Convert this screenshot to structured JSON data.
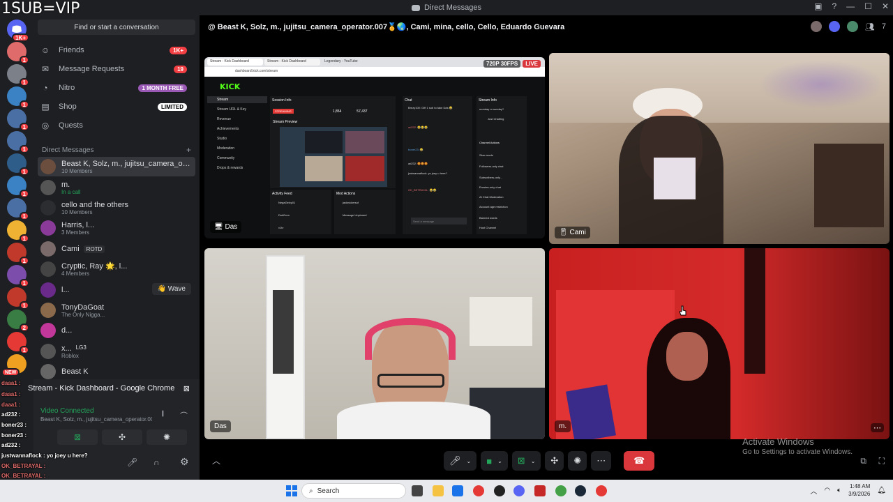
{
  "overlay_text": "1SUB=VIP",
  "window": {
    "title": "Direct Messages"
  },
  "sidebar": {
    "search_placeholder": "Find or start a conversation",
    "nav": [
      {
        "label": "Friends",
        "badge": "1K+"
      },
      {
        "label": "Message Requests",
        "badge": "19"
      },
      {
        "label": "Nitro",
        "badge": "1 MONTH FREE"
      },
      {
        "label": "Shop",
        "badge": "LIMITED"
      },
      {
        "label": "Quests",
        "badge": ""
      }
    ],
    "dm_header": "Direct Messages",
    "dms": [
      {
        "name": "Beast K, Solz, m., jujitsu_camera_opera...",
        "sub": "10 Members"
      },
      {
        "name": "m.",
        "sub": "In a call"
      },
      {
        "name": "cello and the others",
        "sub": "10 Members"
      },
      {
        "name": "Harris, l...",
        "sub": "3 Members"
      },
      {
        "name": "Cami",
        "sub": "",
        "tag": "ROTD"
      },
      {
        "name": "Cryptic, Ray 🌟, l...",
        "sub": "4 Members"
      },
      {
        "name": "l...",
        "sub": "",
        "action": "👋 Wave"
      },
      {
        "name": "TonyDaGoat",
        "sub": "The Only Nigga..."
      },
      {
        "name": "d...",
        "sub": ""
      },
      {
        "name": "x...",
        "sub": "Roblox",
        "tag": "LG3"
      },
      {
        "name": "Beast K",
        "sub": ""
      }
    ]
  },
  "rail": {
    "home_badge": "1K+",
    "badges": [
      "1",
      "1",
      "1",
      "1",
      "1",
      "1",
      "1",
      "1",
      "1",
      "1",
      "1",
      "1",
      "1",
      "1",
      "1",
      "1",
      "2",
      "1"
    ],
    "new_label": "NEW"
  },
  "voice": {
    "stream_title": "Stream - Kick Dashboard - Google Chrome",
    "status": "Video Connected",
    "channel": "Beast K, Solz, m., jujitsu_camera_operator.007..."
  },
  "chat_overlay": [
    "daaa1 :",
    "daaa1 :",
    "daaa1 :",
    "ad232 :",
    "boner23 :",
    "boner23 :",
    "ad232 :",
    "justwannaflock : yo joey u here?",
    "OK_BETRAYAL :",
    "OK_BETRAYAL :"
  ],
  "call": {
    "header": "@ Beast K, Solz, m., jujitsu_camera_operator.007🏅🌏, Cami, mina, cello, Cello, Eduardo Guevara",
    "member_count": "7",
    "tiles": {
      "das_stream": {
        "label": "Das",
        "quality": "720P 30FPS",
        "live": "LIVE"
      },
      "cami": {
        "label": "Cami"
      },
      "das_cam": {
        "label": "Das"
      },
      "m_cam": {
        "label": "m."
      }
    }
  },
  "kick": {
    "logo": "KICK",
    "url": "dashboard.kick.com/stream",
    "tabs": [
      "Stream - Kick Dashboard",
      "Stream - Kick Dashboard",
      "Legendary - YouTube"
    ],
    "nav": [
      "Stream",
      "Stream URL & Key",
      "Revenue",
      "Achievements",
      "Studio",
      "Moderation",
      "Community",
      "Drops & rewards"
    ],
    "session": "Session Info",
    "streaming": "STREAMING",
    "viewers": "1,854",
    "followers": "57,437",
    "preview": "Stream Preview",
    "chat": "Chat",
    "chat_lines": [
      "Brezy100: Gift 1 sub to take Das 😂",
      "ad232: 😂😂😂",
      "boner23: 😂",
      "ad232: 😡😡😡",
      "justwannaflock: yo joey u here?",
      "OK_BETRAYAL: 😂😂"
    ],
    "chat_input": "Send a message",
    "stream_info": "Stream Info",
    "stream_info_q": "monday or sunday?",
    "category": "Just Chatting",
    "actions": [
      "Channel Actions",
      "Slow mode",
      "Followers-only chat",
      "Subscribers-only...",
      "Emotes-only chat",
      "AI Chat Moderation",
      "Account age restriction",
      "Banned words",
      "Host Channel"
    ],
    "activity": "Activity Feed",
    "mod_actions": "Mod Actions",
    "feed": [
      "NegaGelcy01",
      "DubDom",
      "v1tv"
    ],
    "mods": [
      "jacknickersof",
      "Message Unpinned"
    ]
  },
  "activate": {
    "line1": "Activate Windows",
    "line2": "Go to Settings to activate Windows."
  },
  "taskbar": {
    "search": "Search",
    "time": "1:48 AM",
    "date": "3/9/2026"
  },
  "colors": {
    "accent": "#5865f2",
    "danger": "#da373c",
    "kick_green": "#53fc18",
    "online": "#23a55a"
  }
}
